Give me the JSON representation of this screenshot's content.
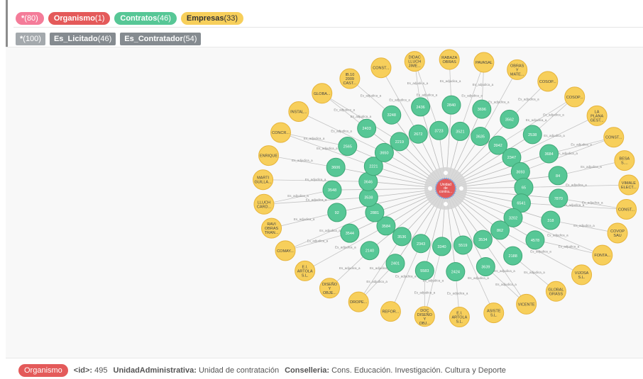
{
  "labels": {
    "all": {
      "name": "*",
      "count": "(80)"
    },
    "organismo": {
      "name": "Organismo",
      "count": "(1)"
    },
    "contratos": {
      "name": "Contratos",
      "count": "(46)"
    },
    "empresas": {
      "name": "Empresas",
      "count": "(33)"
    }
  },
  "relationships": {
    "all": {
      "name": "*",
      "count": "(100)"
    },
    "licitado": {
      "name": "Es_Licitado",
      "count": "(46)"
    },
    "contratador": {
      "name": "Es_Contratador",
      "count": "(54)"
    }
  },
  "colors": {
    "organismo": "#e45a5a",
    "contratos": "#57c796",
    "empresas": "#f7cf5b"
  },
  "graph": {
    "center": [
      "Unidad",
      "de",
      "contra..."
    ],
    "edge_contract": "Es_Licitado",
    "edge_company": "Es_adjudica_a",
    "contracts": [
      "2840",
      "3521",
      "3696",
      "3635",
      "3562",
      "3942",
      "2538",
      "2347",
      "3684",
      "3693",
      "84",
      "65",
      "7870",
      "6541",
      "318",
      "3202",
      "4578",
      "862",
      "2188",
      "3534",
      "3639",
      "5519",
      "2424",
      "3340",
      "5583",
      "2343",
      "2401",
      "3536",
      "2140",
      "3584",
      "3544",
      "2881",
      "92",
      "3538",
      "3548",
      "3646",
      "3606",
      "2221",
      "2565",
      "3650",
      "2403",
      "2219",
      "3248",
      "2672",
      "2436",
      "3723"
    ],
    "companies": [
      "RABAZA OBRAS",
      "PAVASAL",
      "OBRAS Y MATE...",
      "COSOP...",
      "COSOP...",
      "LA PLANA GEST...",
      "CONST...",
      "BESA S....",
      "VIMALE ELECT...",
      "CONST...",
      "COVOP SAU",
      "FONTA...",
      "VIJOSA S.L.",
      "GLOBAL GRASS",
      "VICENTE",
      "ASISTE S.L.",
      "E.I. ARTOLA S.L.",
      "DOC DISEÑO Y OBJ...",
      "REFOR...",
      "DROPE...",
      "DISEÑO Y OBJE...",
      "E.I. ARTOLA S.L.",
      "COMAY...",
      "RAVI OBRAS TRAN...",
      "LLUCH CARD...",
      "MARTI GUILLA...",
      "ENRIQUE",
      "CONCR...",
      "INSTAL...",
      "GLOBA...",
      "IB.10 2009 CAST...",
      "CONST...",
      "DIDAC LLUCH JIME..."
    ]
  },
  "footer": {
    "label": "Organismo",
    "id_key": "<id>:",
    "id_value": "495",
    "ua_key": "UnidadAdministrativa:",
    "ua_value": "Unidad de contratación",
    "cons_key": "Conselleria:",
    "cons_value": "Cons. Educación. Investigación. Cultura y Deporte"
  }
}
